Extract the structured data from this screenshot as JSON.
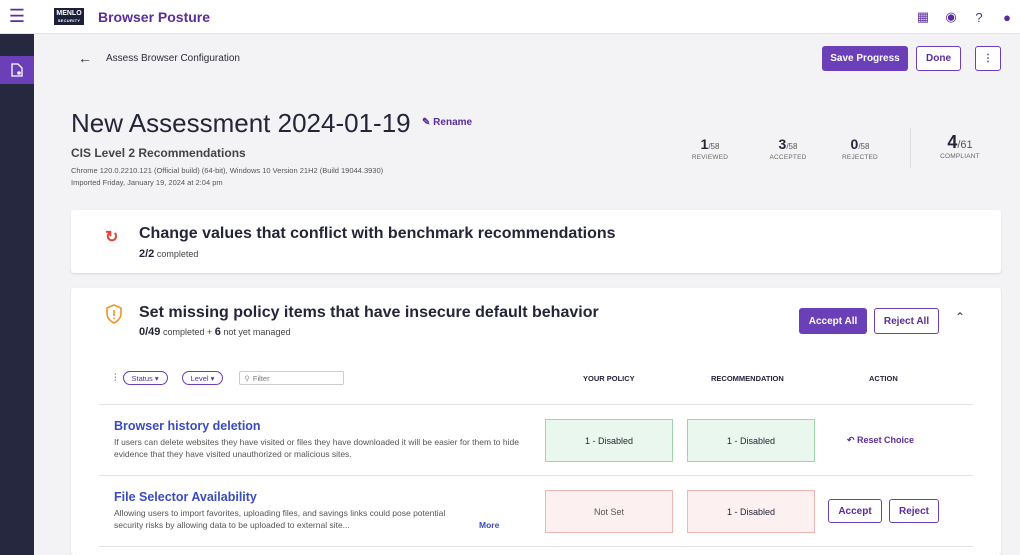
{
  "app": {
    "logo_top": "MENLO",
    "logo_bottom": "SECURITY",
    "title": "Browser Posture"
  },
  "header": {
    "breadcrumb": "Assess Browser Configuration",
    "save_label": "Save Progress",
    "done_label": "Done",
    "more_label": "⋮"
  },
  "assessment": {
    "title": "New Assessment 2024-01-19",
    "rename_label": "Rename",
    "subtitle": "CIS  Level 2 Recommendations",
    "meta_browser": "Chrome 120.0.2210.121 (Official build) (64-bit), Windows 10 Version 21H2 (Build 19044.3930)",
    "meta_imported": "Imported Friday, January 19, 2024 at 2:04 pm"
  },
  "stats": [
    {
      "num": "1",
      "den": "/58",
      "label": "REVIEWED"
    },
    {
      "num": "3",
      "den": "/58",
      "label": "ACCEPTED"
    },
    {
      "num": "0",
      "den": "/58",
      "label": "REJECTED"
    },
    {
      "num": "4",
      "den": "/61",
      "label": "COMPLIANT"
    }
  ],
  "section1": {
    "title": "Change values that conflict with benchmark recommendations",
    "count": "2/2",
    "count_suffix": "completed"
  },
  "section2": {
    "title": "Set missing policy items that have insecure default behavior",
    "count": "0/49",
    "count_suffix": "completed",
    "plus": "+",
    "unmanaged_count": "6",
    "unmanaged_suffix": "not yet managed",
    "accept_all_label": "Accept All",
    "reject_all_label": "Reject All",
    "filter_status": "Status",
    "filter_level": "Level",
    "filter_placeholder": "Filter",
    "col_policy": "YOUR POLICY",
    "col_recommendation": "RECOMMENDATION",
    "col_action": "ACTION",
    "rows": [
      {
        "title": "Browser history deletion",
        "desc": "If users can delete websites they have visited or files they have downloaded it will be easier for them to hide evidence that they have visited unauthorized or malicious sites.",
        "policy": "1 - Disabled",
        "recommendation": "1 - Disabled",
        "action_label": "Reset Choice"
      },
      {
        "title": "File Selector Availability",
        "desc": "Allowing users to import favorites, uploading files, and savings links could pose potential security risks by allowing data to be uploaded to external site...",
        "more_label": "More",
        "policy": "Not Set",
        "recommendation": "1 - Disabled",
        "accept_label": "Accept",
        "reject_label": "Reject"
      }
    ]
  },
  "colors": {
    "accent": "#6a3fb8",
    "sidebar": "#262840",
    "link": "#3a4cc0",
    "warning": "#f0932b",
    "conflict": "#e0443a"
  }
}
